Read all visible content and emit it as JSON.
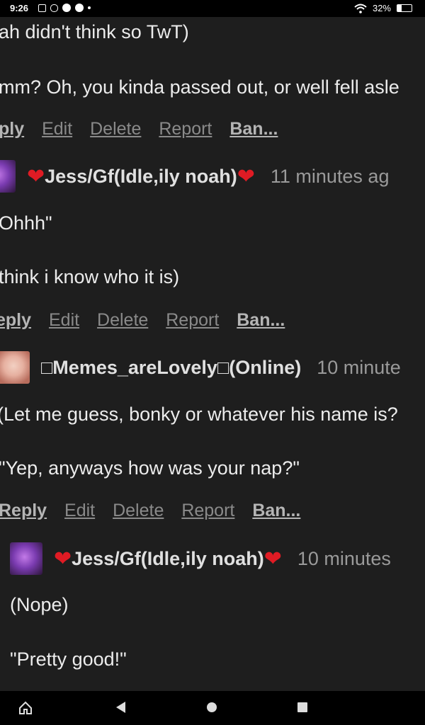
{
  "status": {
    "time": "9:26",
    "battery_text": "32%",
    "battery_level_percent": 32
  },
  "comments": {
    "c1_line1": "ah didn't think so TwT)",
    "c1_line2": "mm? Oh, you kinda passed out, or well fell asle",
    "c1_actions": {
      "reply": "ply",
      "edit": "Edit",
      "delete": "Delete",
      "report": "Report",
      "ban": "Ban..."
    },
    "c2_user": "Jess/Gf(Idle,ily noah)",
    "c2_time": "11 minutes ag",
    "c2_line1": "Ohhh\"",
    "c2_line2": "think i know who it is)",
    "c2_actions": {
      "reply": "eply",
      "edit": "Edit",
      "delete": "Delete",
      "report": "Report",
      "ban": "Ban..."
    },
    "c3_user": "□Memes_areLovely□(Online)",
    "c3_time": "10 minute",
    "c3_line1": "(Let me guess, bonky or whatever his name is?",
    "c3_line2": "\"Yep, anyways how was your nap?\"",
    "c3_actions": {
      "reply": "Reply",
      "edit": "Edit",
      "delete": "Delete",
      "report": "Report",
      "ban": "Ban..."
    },
    "c4_user": "Jess/Gf(Idle,ily noah)",
    "c4_time": "10 minutes",
    "c4_line1": "(Nope)",
    "c4_line2": "\"Pretty good!\""
  },
  "icons": {
    "heart": "❤"
  }
}
